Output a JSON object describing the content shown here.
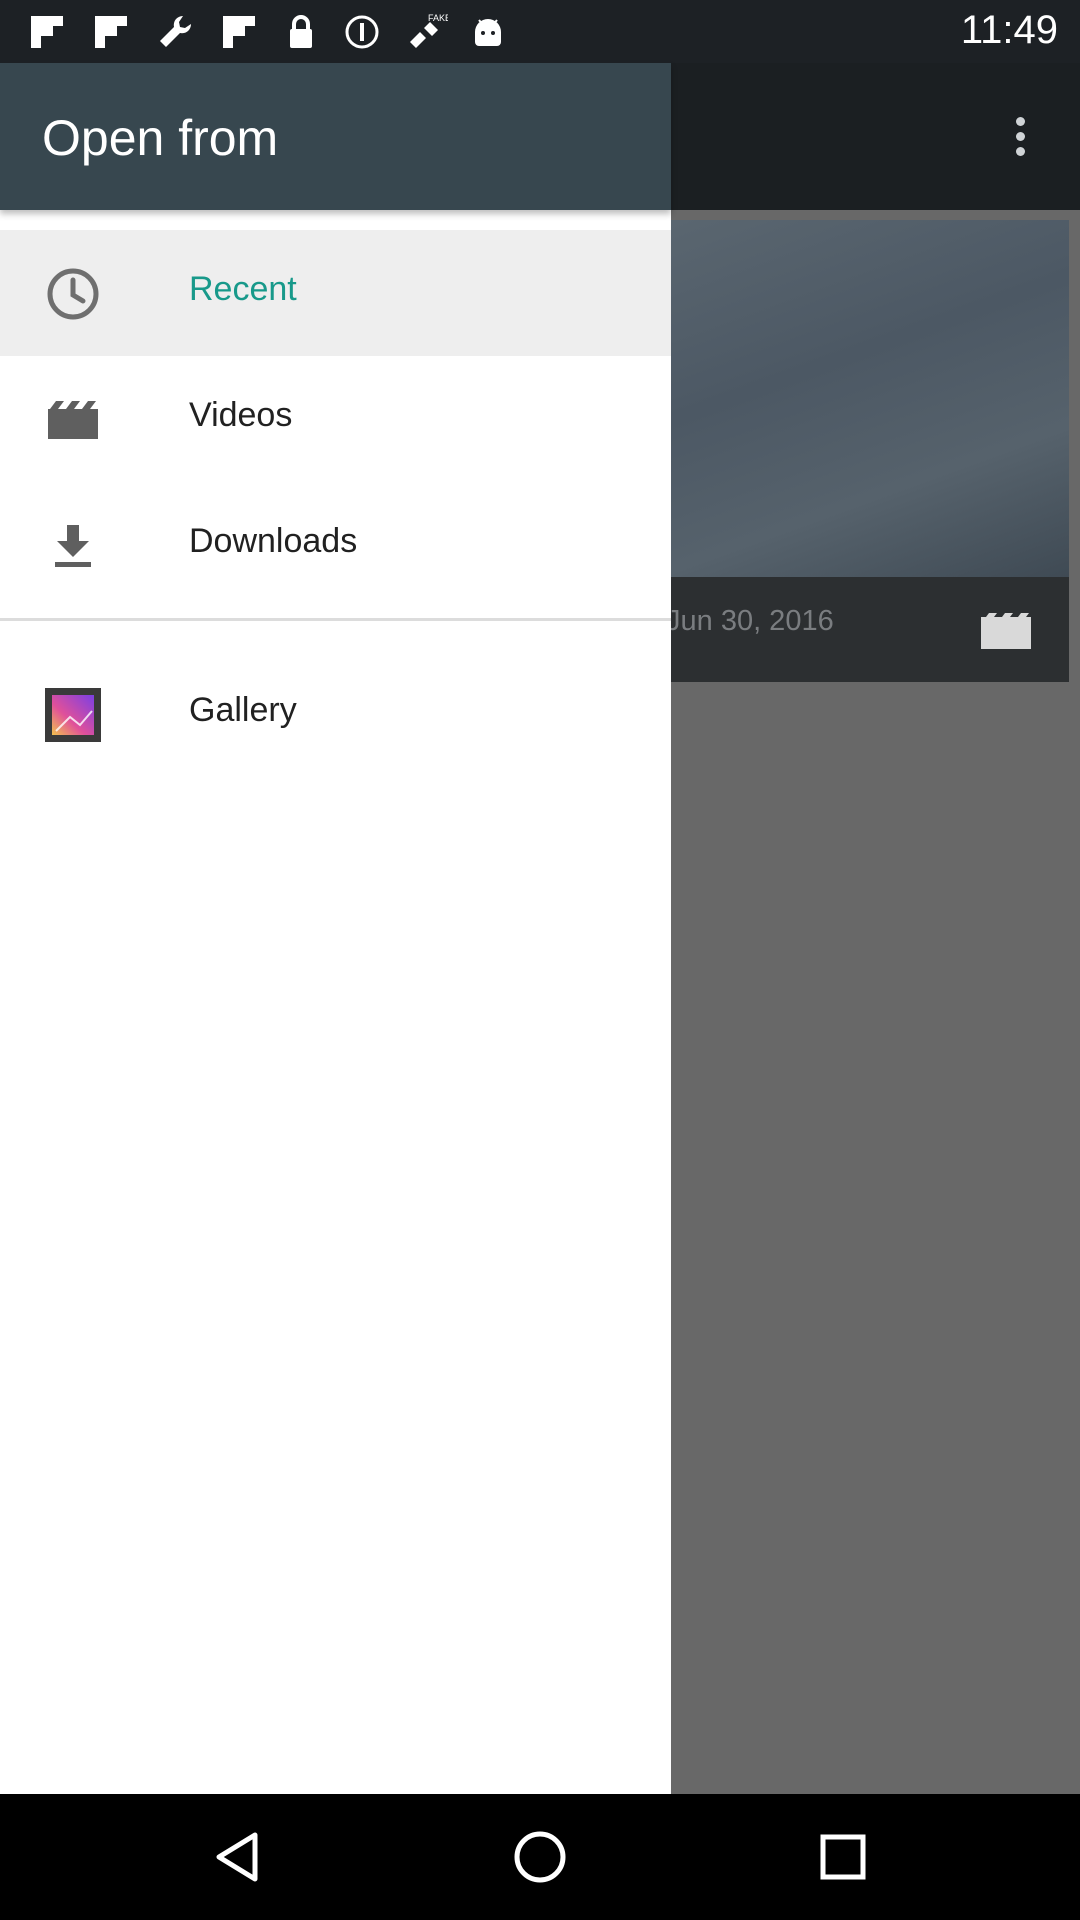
{
  "status_bar": {
    "time": "11:49",
    "icons": [
      "flipboard-icon",
      "flipboard-icon",
      "wrench-icon",
      "flipboard-icon",
      "lock-icon",
      "info-icon",
      "fake-gps-satellite-icon",
      "android-icon"
    ]
  },
  "drawer": {
    "title": "Open from",
    "items": [
      {
        "label": "Recent",
        "icon": "clock-icon",
        "active": true
      },
      {
        "label": "Videos",
        "icon": "video-clapper-icon",
        "active": false
      },
      {
        "label": "Downloads",
        "icon": "download-icon",
        "active": false
      }
    ],
    "apps": [
      {
        "label": "Gallery",
        "icon": "gallery-app-icon"
      }
    ]
  },
  "background": {
    "card_date": "Jun 30, 2016",
    "card_icon": "video-clapper-icon"
  },
  "colors": {
    "accent": "#18998a",
    "header": "#37474f",
    "status_bar": "#1d2125"
  },
  "nav_bar": {
    "buttons": [
      "back-icon",
      "home-icon",
      "recents-icon"
    ]
  }
}
